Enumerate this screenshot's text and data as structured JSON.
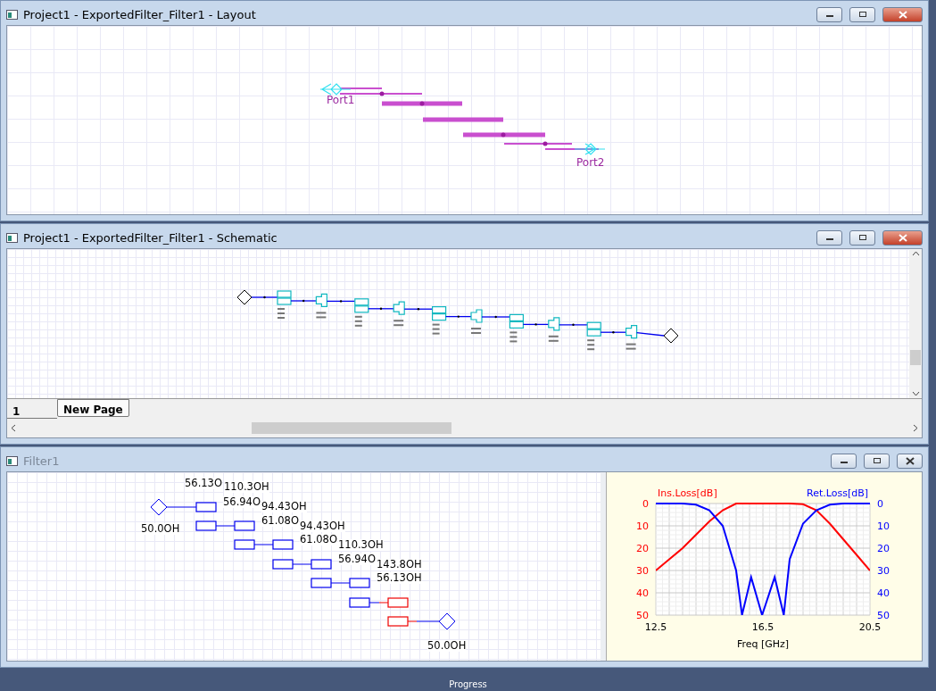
{
  "windows": [
    {
      "kind": "layout",
      "title": "Project1 - ExportedFilter_Filter1 - Layout",
      "active": true,
      "ports": [
        "Port1",
        "Port2"
      ]
    },
    {
      "kind": "schematic",
      "title": "Project1 - ExportedFilter_Filter1 - Schematic",
      "active": true,
      "page_tabs": [
        {
          "label": "1",
          "selected": true
        },
        {
          "label": "New Page",
          "selected": false
        }
      ]
    },
    {
      "kind": "filter",
      "title": "Filter1",
      "active": false,
      "circuit_labels": [
        "56.13O",
        "110.3OH",
        "56.94O",
        "94.43OH",
        "61.08O",
        "94.43OH",
        "61.08O",
        "110.3OH",
        "56.94O",
        "143.8OH",
        "56.13OH",
        "50.0OH",
        "50.0OH"
      ],
      "chart_data": {
        "type": "line",
        "xlabel": "Freq [GHz]",
        "x": [
          12.5,
          13,
          13.5,
          14,
          14.5,
          15,
          15.5,
          15.72,
          16.06,
          16.47,
          16.94,
          17.28,
          17.5,
          18,
          18.5,
          19,
          19.5,
          20,
          20.5
        ],
        "series": [
          {
            "name": "Ins.Loss[dB]",
            "color": "#ff0000",
            "values": [
              30,
              25,
              20,
              14,
              8,
              3,
              0,
              0,
              0,
              0,
              0,
              0,
              0,
              0.3,
              3,
              9,
              16,
              23,
              30
            ]
          },
          {
            "name": "Ret.Loss[dB]",
            "color": "#0000ff",
            "values": [
              0,
              0,
              0,
              0.5,
              3,
              10,
              30,
              50,
              33,
              50,
              33,
              50,
              25,
              9,
              3,
              0.5,
              0,
              0,
              0
            ]
          }
        ],
        "xlim": [
          12.5,
          20.5
        ],
        "ylim": [
          50,
          0
        ],
        "xticks": [
          12.5,
          16.5,
          20.5
        ],
        "yticks": [
          0,
          10,
          20,
          30,
          40,
          50
        ],
        "y2ticks": [
          0,
          10,
          20,
          30,
          40,
          50
        ],
        "y2lim": [
          50,
          0
        ],
        "grid": true
      }
    }
  ],
  "status_bar": {
    "text": "Progress"
  }
}
